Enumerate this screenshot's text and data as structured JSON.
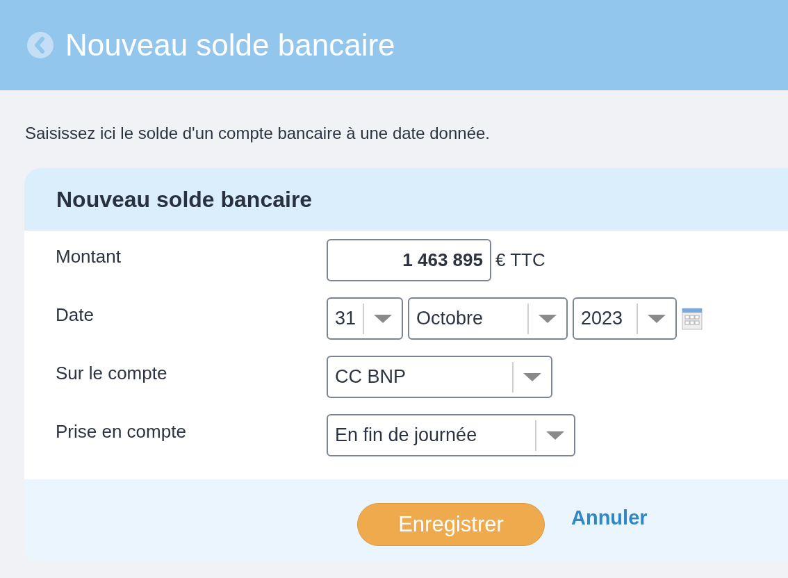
{
  "header": {
    "title": "Nouveau solde bancaire"
  },
  "intro": "Saisissez ici le solde d'un compte bancaire à une date donnée.",
  "form": {
    "title": "Nouveau solde bancaire",
    "rows": [
      {
        "kind": "amount",
        "label": "Montant",
        "value": "1 463 895",
        "unit": "€ TTC"
      },
      {
        "kind": "date",
        "label": "Date",
        "selects": [
          "31",
          "Octobre",
          "2023"
        ]
      },
      {
        "kind": "select",
        "label": "Sur le compte",
        "value": "CC BNP"
      },
      {
        "kind": "select",
        "label": "Prise en compte",
        "value": "En fin de journée"
      }
    ]
  },
  "buttons": {
    "save": "Enregistrer",
    "cancel": "Annuler"
  }
}
